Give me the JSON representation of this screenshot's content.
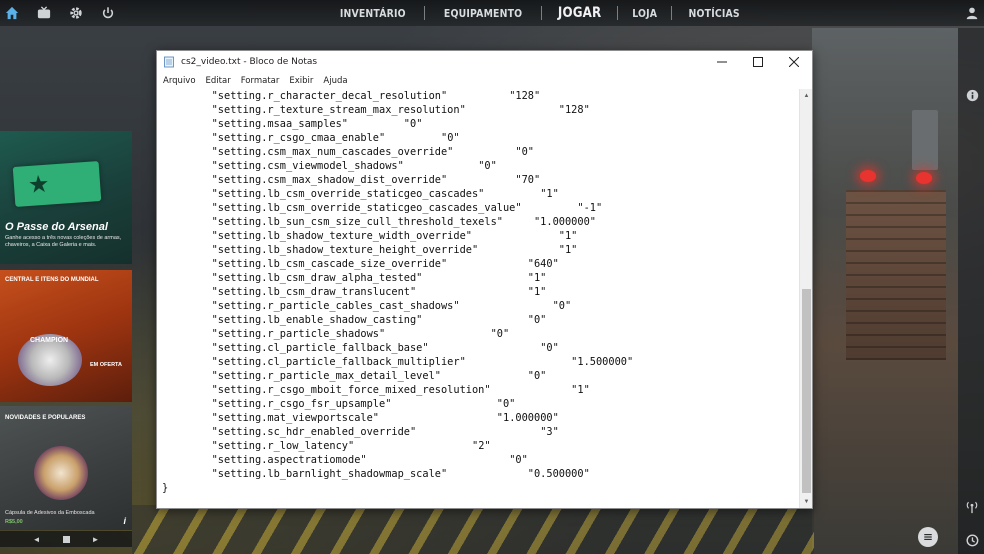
{
  "topbar": {
    "left_icons": [
      "home-icon",
      "tv-icon",
      "gear-icon",
      "power-icon"
    ],
    "nav": [
      {
        "label": "INVENTÁRIO",
        "active": false
      },
      {
        "label": "EQUIPAMENTO",
        "active": false
      },
      {
        "label": "JOGAR",
        "active": true
      },
      {
        "label": "LOJA",
        "active": false
      },
      {
        "label": "NOTÍCIAS",
        "active": false
      }
    ],
    "right_icon": "profile-icon"
  },
  "promo_cards": {
    "card1": {
      "title": "O Passe do Arsenal",
      "subtitle": "Ganhe acesso a três novas coleções de armas, chaveiros, a Caixa de Galeria e mais."
    },
    "card2": {
      "title": "CENTRAL E ITENS DO MUNDIAL",
      "badge": "CHAMPION",
      "offer": "EM OFERTA"
    },
    "card3": {
      "title": "NOVIDADES E POPULARES",
      "item_name": "Cápsula de Adesivos da Emboscada",
      "price": "R$5,00",
      "info": "i"
    },
    "carousel": {
      "prev": "◄",
      "next": "►"
    }
  },
  "notepad": {
    "title": "cs2_video.txt - Bloco de Notas",
    "menu": [
      "Arquivo",
      "Editar",
      "Formatar",
      "Exibir",
      "Ajuda"
    ],
    "lines": [
      {
        "key": "\"setting.r_character_decal_resolution\"",
        "value": "\"128\"",
        "pad": 10
      },
      {
        "key": "\"setting.r_texture_stream_max_resolution\"",
        "value": "\"128\"",
        "pad": 15
      },
      {
        "key": "\"setting.msaa_samples\"",
        "value": "\"0\"",
        "pad": 9
      },
      {
        "key": "\"setting.r_csgo_cmaa_enable\"",
        "value": "\"0\"",
        "pad": 9
      },
      {
        "key": "\"setting.csm_max_num_cascades_override\"",
        "value": "\"0\"",
        "pad": 10
      },
      {
        "key": "\"setting.csm_viewmodel_shadows\"",
        "value": "\"0\"",
        "pad": 12
      },
      {
        "key": "\"setting.csm_max_shadow_dist_override\"",
        "value": "\"70\"",
        "pad": 11
      },
      {
        "key": "\"setting.lb_csm_override_staticgeo_cascades\"",
        "value": "\"1\"",
        "pad": 9
      },
      {
        "key": "\"setting.lb_csm_override_staticgeo_cascades_value\"",
        "value": "\"-1\"",
        "pad": 9
      },
      {
        "key": "\"setting.lb_sun_csm_size_cull_threshold_texels\"",
        "value": "\"1.000000\"",
        "pad": 5
      },
      {
        "key": "\"setting.lb_shadow_texture_width_override\"",
        "value": "\"1\"",
        "pad": 14
      },
      {
        "key": "\"setting.lb_shadow_texture_height_override\"",
        "value": "\"1\"",
        "pad": 13
      },
      {
        "key": "\"setting.lb_csm_cascade_size_override\"",
        "value": "\"640\"",
        "pad": 13
      },
      {
        "key": "\"setting.lb_csm_draw_alpha_tested\"",
        "value": "\"1\"",
        "pad": 17
      },
      {
        "key": "\"setting.lb_csm_draw_translucent\"",
        "value": "\"1\"",
        "pad": 18
      },
      {
        "key": "\"setting.r_particle_cables_cast_shadows\"",
        "value": "\"0\"",
        "pad": 15
      },
      {
        "key": "\"setting.lb_enable_shadow_casting\"",
        "value": "\"0\"",
        "pad": 17
      },
      {
        "key": "\"setting.r_particle_shadows\"",
        "value": "\"0\"",
        "pad": 17
      },
      {
        "key": "\"setting.cl_particle_fallback_base\"",
        "value": "\"0\"",
        "pad": 18
      },
      {
        "key": "\"setting.cl_particle_fallback_multiplier\"",
        "value": "\"1.500000\"",
        "pad": 17
      },
      {
        "key": "\"setting.r_particle_max_detail_level\"",
        "value": "\"0\"",
        "pad": 14
      },
      {
        "key": "\"setting.r_csgo_mboit_force_mixed_resolution\"",
        "value": "\"1\"",
        "pad": 13
      },
      {
        "key": "\"setting.r_csgo_fsr_upsample\"",
        "value": "\"0\"",
        "pad": 17
      },
      {
        "key": "\"setting.mat_viewportscale\"",
        "value": "\"1.000000\"",
        "pad": 19
      },
      {
        "key": "\"setting.sc_hdr_enabled_override\"",
        "value": "\"3\"",
        "pad": 20
      },
      {
        "key": "\"setting.r_low_latency\"",
        "value": "\"2\"",
        "pad": 19
      },
      {
        "key": "\"setting.aspectratiomode\"",
        "value": "\"0\"",
        "pad": 23
      },
      {
        "key": "\"setting.lb_barnlight_shadowmap_scale\"",
        "value": "\"0.500000\"",
        "pad": 13
      },
      {
        "key": "}",
        "value": "",
        "pad": 0,
        "indent": 0
      }
    ]
  },
  "right_rail": {
    "icons": [
      "info-icon",
      "antenna-icon",
      "history-icon"
    ],
    "chat_icon": "chat-icon"
  }
}
